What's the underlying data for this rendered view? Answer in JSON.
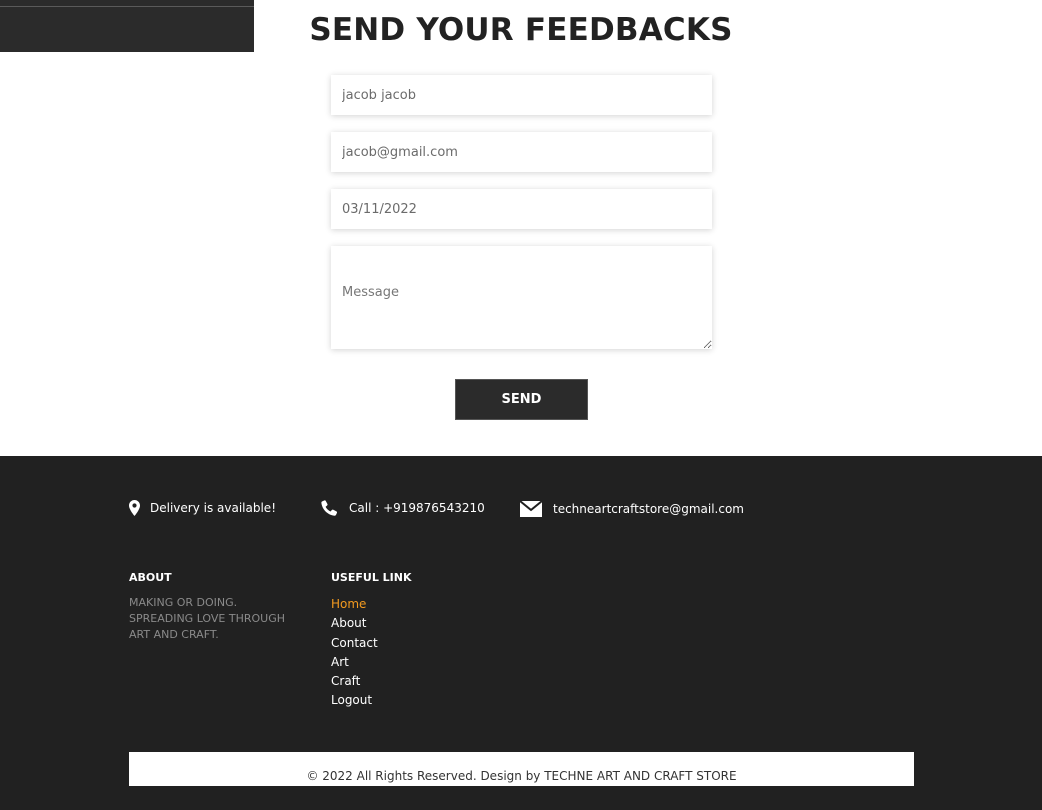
{
  "page": {
    "title": "SEND YOUR FEEDBACKS"
  },
  "form": {
    "name_value": "jacob jacob",
    "email_value": "jacob@gmail.com",
    "date_value": "03/11/2022",
    "message_placeholder": "Message",
    "send_label": "SEND"
  },
  "footer": {
    "info": {
      "delivery": "Delivery is available!",
      "call": "Call : +919876543210",
      "email": "techneartcraftstore@gmail.com"
    },
    "about": {
      "heading": "ABOUT",
      "text": "MAKING OR DOING. SPREADING LOVE THROUGH ART AND CRAFT."
    },
    "useful_link": {
      "heading": "USEFUL LINK",
      "items": [
        "Home",
        "About",
        "Contact",
        "Art",
        "Craft",
        "Logout"
      ]
    },
    "copyright": "© 2022 All Rights Reserved. Design by TECHNE ART AND CRAFT STORE"
  },
  "colors": {
    "dark": "#212121",
    "accent": "#f39a1f"
  },
  "icons": {
    "delivery": "map-pin-icon",
    "call": "phone-icon",
    "email": "envelope-icon"
  }
}
